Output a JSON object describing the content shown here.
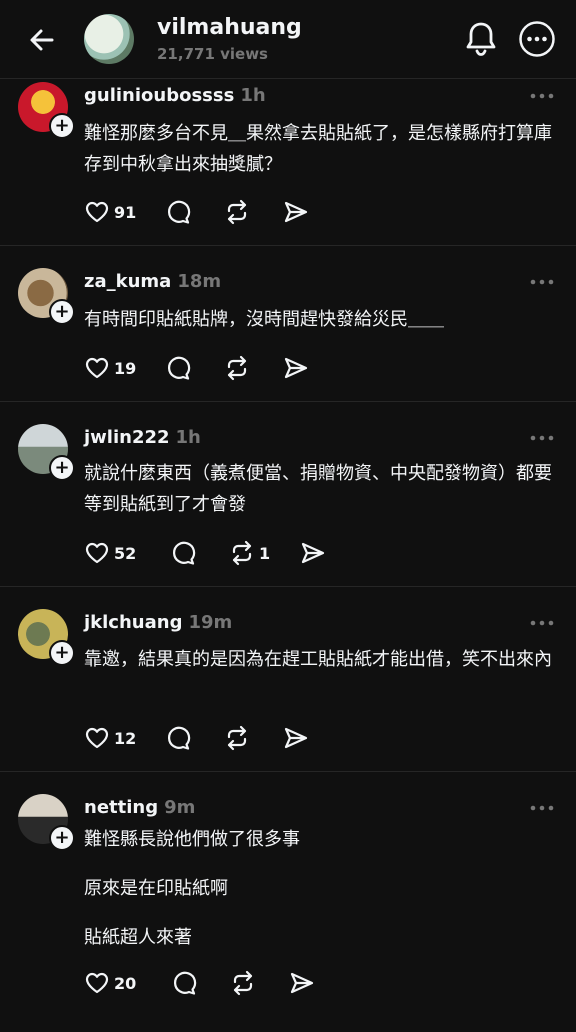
{
  "header": {
    "username": "vilmahuang",
    "views": "21,771 views"
  },
  "posts": [
    {
      "username": "gulinioubossss",
      "time": "1h",
      "lines": [
        "難怪那麼多台不見＿果然拿去貼貼紙了，是怎樣縣府打算庫存到中秋拿出來抽獎膩？"
      ],
      "likes": "91",
      "reposts": ""
    },
    {
      "username": "za_kuma",
      "time": "18m",
      "lines": [
        "有時間印貼紙貼牌，沒時間趕快發給災民＿＿"
      ],
      "likes": "19",
      "reposts": ""
    },
    {
      "username": "jwlin222",
      "time": "1h",
      "lines": [
        "就說什麼東西（義煮便當、捐贈物資、中央配發物資）都要等到貼紙到了才會發"
      ],
      "likes": "52",
      "reposts": "1"
    },
    {
      "username": "jklchuang",
      "time": "19m",
      "lines": [
        "靠邀，結果真的是因為在趕工貼貼紙才能出借，笑不出來內"
      ],
      "likes": "12",
      "reposts": ""
    },
    {
      "username": "netting",
      "time": "9m",
      "lines": [
        "難怪縣長說他們做了很多事",
        "原來是在印貼紙啊",
        "貼紙超人來著"
      ],
      "likes": "20",
      "reposts": ""
    }
  ]
}
